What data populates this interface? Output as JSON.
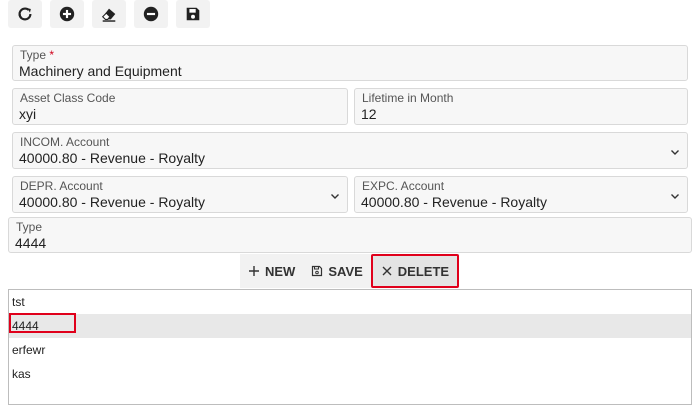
{
  "toolbar": {
    "buttons": [
      {
        "name": "refresh-button",
        "icon": "refresh-icon"
      },
      {
        "name": "add-button",
        "icon": "plus-circle-icon"
      },
      {
        "name": "clear-button",
        "icon": "eraser-icon"
      },
      {
        "name": "remove-button",
        "icon": "minus-circle-icon"
      },
      {
        "name": "save-button",
        "icon": "floppy-disk-icon"
      }
    ]
  },
  "form": {
    "type": {
      "label": "Type",
      "required_mark": "*",
      "value": "Machinery and Equipment"
    },
    "asset_class_code": {
      "label": "Asset Class Code",
      "value": "xyi"
    },
    "lifetime": {
      "label": "Lifetime in Month",
      "value": "12"
    },
    "income_account": {
      "label": "INCOM. Account",
      "value": "40000.80 - Revenue - Royalty"
    },
    "depr_account": {
      "label": "DEPR. Account",
      "value": "40000.80 - Revenue - Royalty"
    },
    "expc_account": {
      "label": "EXPC. Account",
      "value": "40000.80 - Revenue - Royalty"
    },
    "sub_type": {
      "label": "Type",
      "value": "4444"
    }
  },
  "actions": {
    "new_label": "NEW",
    "save_label": "SAVE",
    "delete_label": "DELETE"
  },
  "list": {
    "items": [
      "tst",
      "4444",
      "erfewr",
      "kas"
    ],
    "selected_index": 1
  },
  "colors": {
    "highlight": "#e0001b",
    "required": "#d0021b",
    "selected_row": "#e8e8e8"
  }
}
